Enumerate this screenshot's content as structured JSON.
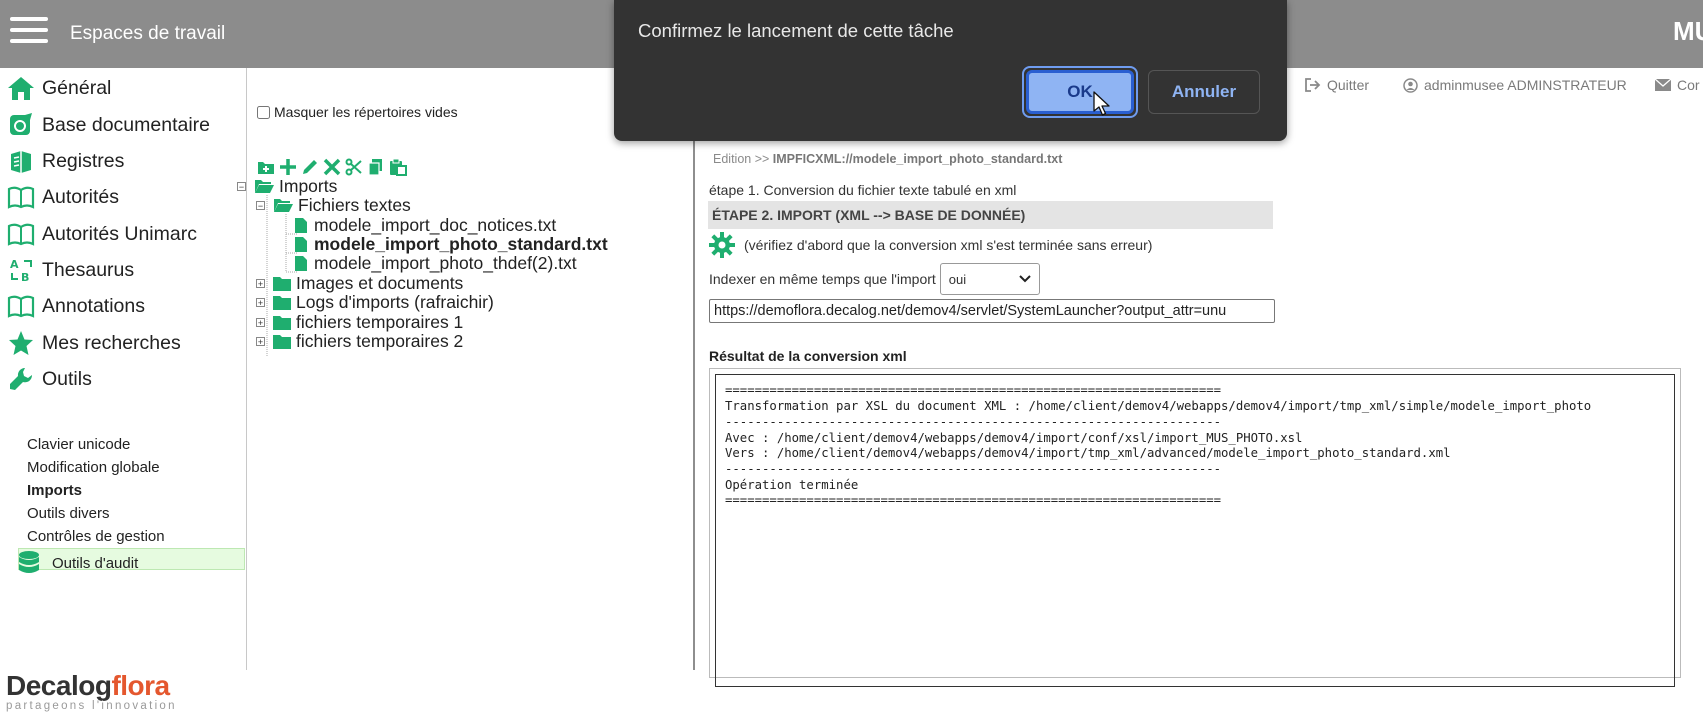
{
  "header": {
    "title": "Espaces de travail",
    "brand": "MUS"
  },
  "sidebar": {
    "items": [
      {
        "label": "Général",
        "icon": "home-icon"
      },
      {
        "label": "Base documentaire",
        "icon": "document-base-icon"
      },
      {
        "label": "Registres",
        "icon": "books-icon"
      },
      {
        "label": "Autorités",
        "icon": "open-book-icon"
      },
      {
        "label": "Autorités Unimarc",
        "icon": "open-book-icon"
      },
      {
        "label": "Thesaurus",
        "icon": "thesaurus-icon"
      },
      {
        "label": "Annotations",
        "icon": "open-book-icon"
      },
      {
        "label": "Mes recherches",
        "icon": "star-icon"
      },
      {
        "label": "Outils",
        "icon": "wrench-icon"
      }
    ],
    "sub_items": [
      {
        "label": "Clavier unicode"
      },
      {
        "label": "Modification globale"
      },
      {
        "label": "Imports",
        "active": true
      },
      {
        "label": "Outils divers"
      },
      {
        "label": "Contrôles de gestion"
      },
      {
        "label": "Outils d'audit",
        "icon": "database-icon"
      }
    ],
    "logo": {
      "main_a": "Decalog",
      "main_b": "flora",
      "tagline": "partageons l'innovation"
    }
  },
  "tree": {
    "hide_empty_label": "Masquer les répertoires vides",
    "hide_empty_checked": false,
    "toolbar": [
      "new-folder-icon",
      "add-icon",
      "edit-pencil-icon",
      "delete-x-icon",
      "cut-scissors-icon",
      "copy-icon",
      "paste-icon"
    ],
    "root": "Imports",
    "folder_textes": "Fichiers textes",
    "files": [
      {
        "label": "modele_import_doc_notices.txt",
        "selected": false
      },
      {
        "label": "modele_import_photo_standard.txt",
        "selected": true
      },
      {
        "label": "modele_import_photo_thdef(2).txt",
        "selected": false
      }
    ],
    "folders": [
      {
        "label": "Images et documents"
      },
      {
        "label": "Logs d'imports (rafraichir)"
      },
      {
        "label": "fichiers temporaires 1"
      },
      {
        "label": "fichiers temporaires 2"
      }
    ]
  },
  "topbar": {
    "quit": "Quitter",
    "user": "adminmusee ADMINSTRATEUR",
    "contact": "Cor"
  },
  "main": {
    "breadcrumb_prefix": "Edition >>",
    "breadcrumb_path": "IMPFICXML://modele_import_photo_standard.txt",
    "step1": "étape 1. Conversion du fichier texte tabulé en xml",
    "step2": "ÉTAPE 2. IMPORT (XML --> BASE DE DONNÉE)",
    "verify": "(vérifiez d'abord que la conversion xml s'est terminée sans erreur)",
    "index_label": "Indexer en même temps que l'import",
    "index_value": "oui",
    "url": "https://demoflora.decalog.net/demov4/servlet/SystemLauncher?output_attr=unu",
    "result_title": "Résultat de la conversion xml",
    "result_lines": [
      "===================================================================",
      "Transformation par XSL du document XML : /home/client/demov4/webapps/demov4/import/tmp_xml/simple/modele_import_photo",
      "-------------------------------------------------------------------",
      "Avec : /home/client/demov4/webapps/demov4/import/conf/xsl/import_MUS_PHOTO.xsl",
      "Vers : /home/client/demov4/webapps/demov4/import/tmp_xml/advanced/modele_import_photo_standard.xml",
      "-------------------------------------------------------------------",
      "Opération terminée",
      "==================================================================="
    ]
  },
  "modal": {
    "message": "Confirmez le lancement de cette tâche",
    "ok": "OK",
    "cancel": "Annuler"
  },
  "colors": {
    "accent_green": "#1fae6f",
    "header_gray": "#8c8c8c",
    "modal_bg": "#333333",
    "ok_blue": "#8fb4f3"
  }
}
